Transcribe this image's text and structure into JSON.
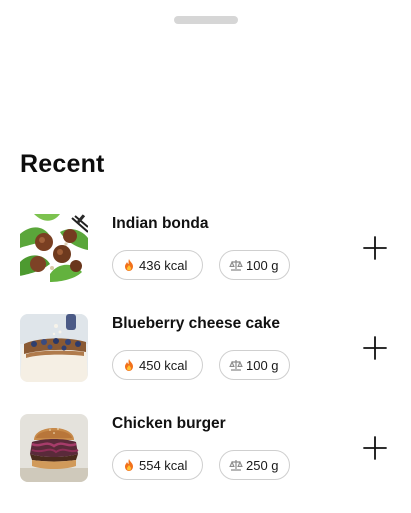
{
  "section_title": "Recent",
  "items": [
    {
      "name": "Indian bonda",
      "calories": "436 kcal",
      "weight": "100 g",
      "image": "meatballs-salad-photo"
    },
    {
      "name": "Blueberry cheese cake",
      "calories": "450 kcal",
      "weight": "100 g",
      "image": "blueberry-cake-photo"
    },
    {
      "name": "Chicken burger",
      "calories": "554 kcal",
      "weight": "250 g",
      "image": "burger-photo"
    }
  ],
  "icons": {
    "calories": "flame-icon",
    "weight": "scale-icon",
    "add": "plus-icon"
  },
  "colors": {
    "chip_border": "#cfcfcf",
    "flame": "#f2711c",
    "handle": "#d6d6d6"
  }
}
